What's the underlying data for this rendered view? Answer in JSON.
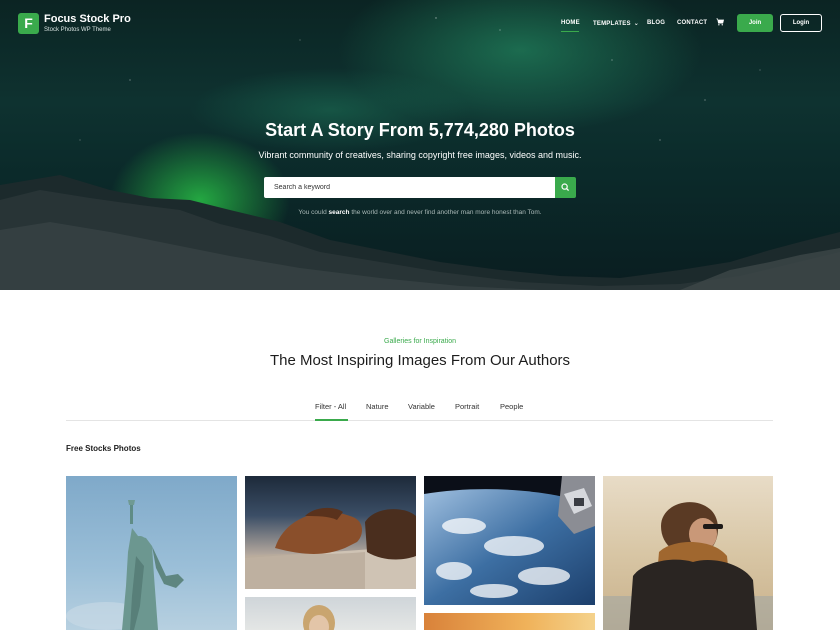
{
  "brand": {
    "logo_letter": "F",
    "name": "Focus Stock Pro",
    "tagline": "Stock Photos WP Theme"
  },
  "nav": {
    "items": [
      {
        "label": "HOME",
        "active": true
      },
      {
        "label": "TEMPLATES",
        "has_dropdown": true
      },
      {
        "label": "BLOG"
      },
      {
        "label": "CONTACT"
      }
    ],
    "cart_icon": "cart-icon",
    "join_label": "Join",
    "login_label": "Login"
  },
  "hero": {
    "title": "Start A Story From 5,774,280 Photos",
    "subtitle": "Vibrant community of creatives, sharing copyright free images, videos and music.",
    "search_placeholder": "Search a keyword",
    "search_icon": "search-icon",
    "hint_before": "You could",
    "hint_bold": "search",
    "hint_after": "the world over and never find another man more honest than Tom."
  },
  "section": {
    "eyebrow": "Galleries for Inspiration",
    "title": "The Most Inspiring Images From Our Authors",
    "filters": [
      "Filter - All",
      "Nature",
      "Variable",
      "Portrait",
      "People"
    ],
    "active_filter": "Filter - All",
    "gallery_heading": "Free Stocks Photos"
  },
  "gallery": {
    "photos": [
      {
        "subject": "statue-of-liberty"
      },
      {
        "subject": "horses"
      },
      {
        "subject": "earth-from-space"
      },
      {
        "subject": "person-with-scarf"
      },
      {
        "subject": "woman-portrait"
      },
      {
        "subject": "warm-gradient"
      }
    ]
  },
  "colors": {
    "accent": "#3aaa4c",
    "hero_bg": "#0e3230",
    "text": "#1d1d1d"
  }
}
